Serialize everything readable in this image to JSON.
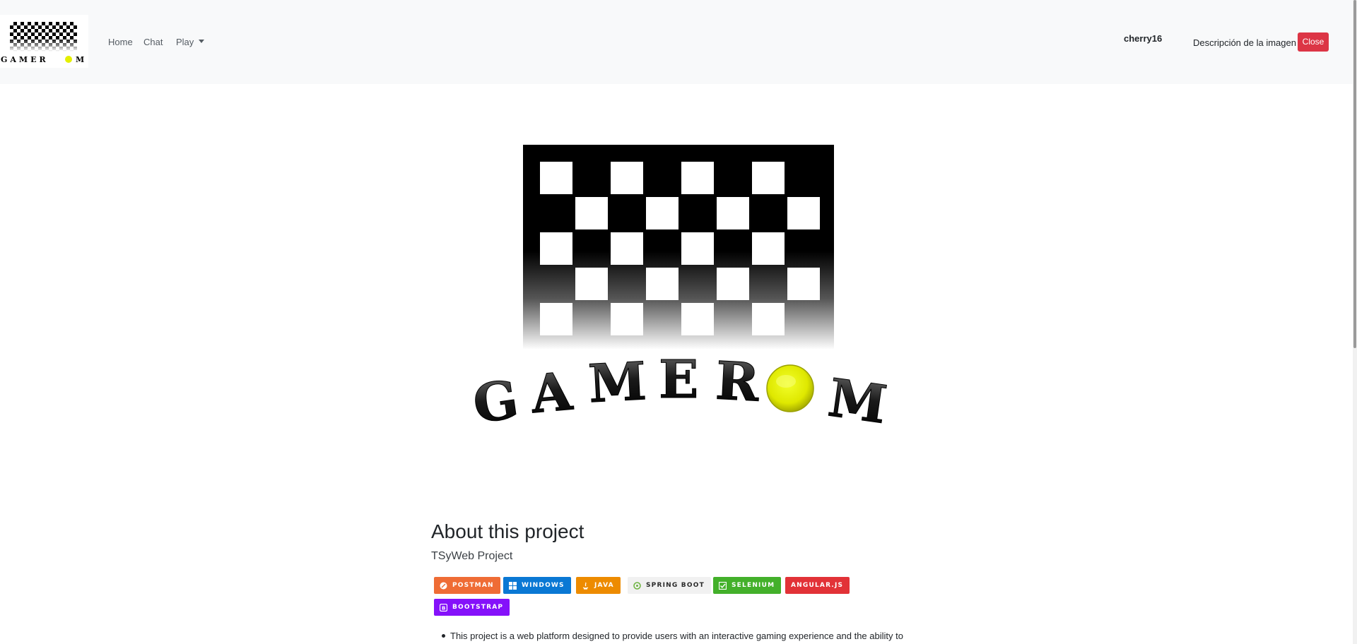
{
  "nav": {
    "logo_text": "GAMEROM",
    "links": [
      "Home",
      "Chat",
      "Play"
    ],
    "username": "cherry16",
    "image_description": "Descripción de la imagen",
    "close_label": "Close"
  },
  "hero": {
    "logo_text": "GAMEROM"
  },
  "about": {
    "title": "About this project",
    "subtitle": "TSyWeb Project",
    "badges": [
      {
        "label": "POSTMAN",
        "color": "#ef6c35",
        "icon": "postman-icon"
      },
      {
        "label": "WINDOWS",
        "color": "#0a78d4",
        "icon": "windows-icon"
      },
      {
        "label": "JAVA",
        "color": "#ed8b00",
        "icon": "java-icon"
      },
      {
        "label": "SPRING BOOT",
        "color": "#f1f1f1",
        "text_color": "#2a2a2a",
        "icon": "spring-icon"
      },
      {
        "label": "SELENIUM",
        "color": "#43b02a",
        "icon": "selenium-icon"
      },
      {
        "label": "ANGULAR.JS",
        "color": "#e23237",
        "icon": "angular-icon"
      },
      {
        "label": "BOOTSTRAP",
        "color": "#8511fa",
        "icon": "bootstrap-icon"
      }
    ],
    "description": "This project is a web platform designed to provide users with an interactive gaming experience and the ability to"
  },
  "colors": {
    "navbar_bg": "#f8f9fa",
    "close_button": "#dc3545",
    "logo_ball": "#e4ef00"
  }
}
